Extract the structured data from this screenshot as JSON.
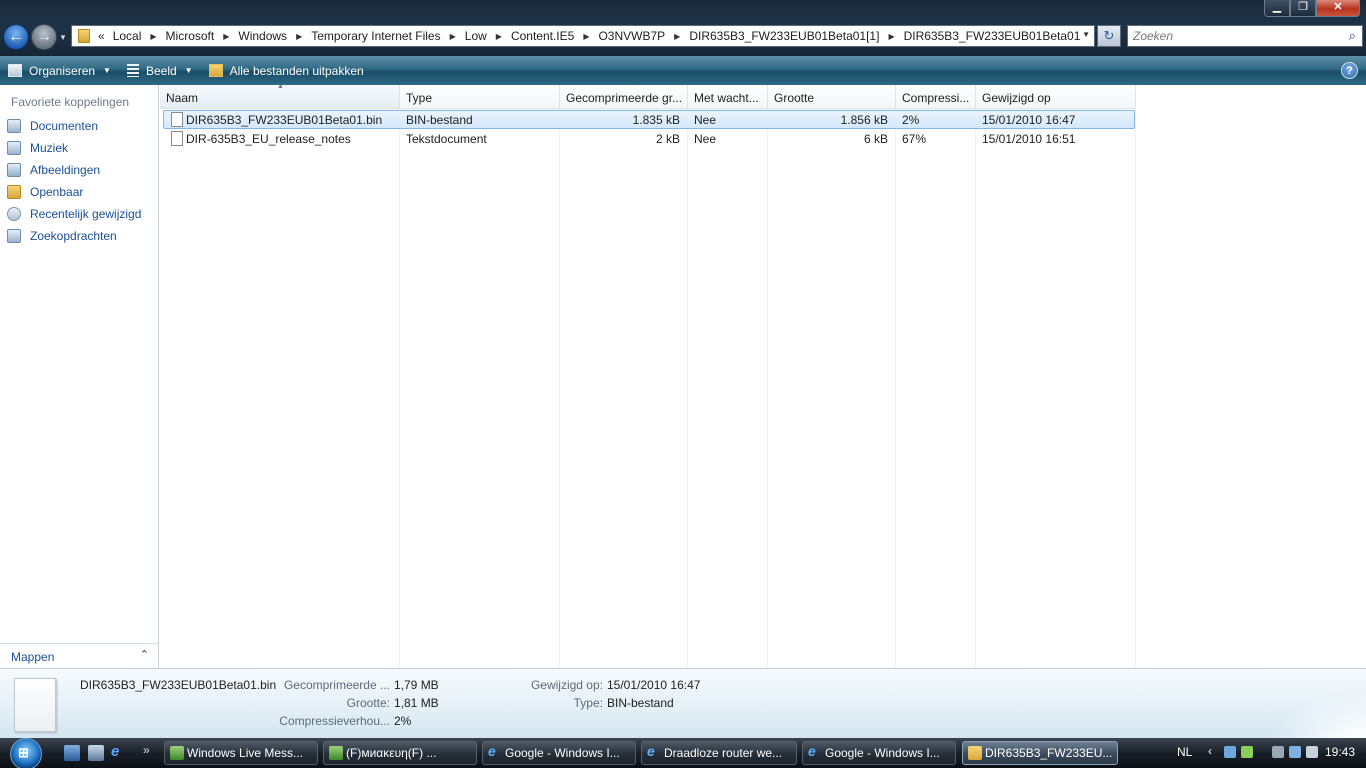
{
  "window": {
    "controls": {
      "minimize": "▁",
      "maximize": "❐",
      "close": "✕"
    }
  },
  "nav": {
    "back": "←",
    "forward": "→",
    "dropdown": "▼"
  },
  "address": {
    "chevron": "«",
    "segments": [
      "Local",
      "Microsoft",
      "Windows",
      "Temporary Internet Files",
      "Low",
      "Content.IE5",
      "O3NVWB7P",
      "DIR635B3_FW233EUB01Beta01[1]",
      "DIR635B3_FW233EUB01Beta01"
    ],
    "separator": "▶",
    "dropdown": "▼",
    "refresh": "↻"
  },
  "search": {
    "placeholder": "Zoeken",
    "icon": "⌕"
  },
  "toolbar": {
    "organize": "Organiseren",
    "view": "Beeld",
    "extract": "Alle bestanden uitpakken",
    "dropdown": "▼",
    "help": "?"
  },
  "navpane": {
    "heading": "Favoriete koppelingen",
    "items": [
      "Documenten",
      "Muziek",
      "Afbeeldingen",
      "Openbaar",
      "Recentelijk gewijzigd",
      "Zoekopdrachten"
    ],
    "folders": "Mappen",
    "folders_toggle": "⌃"
  },
  "columns": [
    "Naam",
    "Type",
    "Gecomprimeerde gr...",
    "Met wacht...",
    "Grootte",
    "Compressi...",
    "Gewijzigd op"
  ],
  "sort_indicator": "▲",
  "files": [
    {
      "name": "DIR635B3_FW233EUB01Beta01.bin",
      "type": "BIN-bestand",
      "compressed": "1.835 kB",
      "password": "Nee",
      "size": "1.856 kB",
      "ratio": "2%",
      "modified": "15/01/2010 16:47"
    },
    {
      "name": "DIR-635B3_EU_release_notes",
      "type": "Tekstdocument",
      "compressed": "2 kB",
      "password": "Nee",
      "size": "6 kB",
      "ratio": "67%",
      "modified": "15/01/2010 16:51"
    }
  ],
  "details": {
    "filename": "DIR635B3_FW233EUB01Beta01.bin",
    "compressed_label": "Gecomprimeerde ...",
    "compressed_value": "1,79 MB",
    "size_label": "Grootte:",
    "size_value": "1,81 MB",
    "ratio_label": "Compressieverhou...",
    "ratio_value": "2%",
    "modified_label": "Gewijzigd op:",
    "modified_value": "15/01/2010 16:47",
    "type_label": "Type:",
    "type_value": "BIN-bestand"
  },
  "taskbar": {
    "start_glyph": "⊞",
    "quicklaunch_more": "»",
    "ie_glyph": "e",
    "tasks": [
      {
        "label": "Windows Live Mess...",
        "icon": "msn"
      },
      {
        "label": "(F)миακευη(F)      ...",
        "icon": "msn"
      },
      {
        "label": "Google - Windows I...",
        "icon": "ie"
      },
      {
        "label": "Draadloze router we...",
        "icon": "ie"
      },
      {
        "label": "Google - Windows I...",
        "icon": "ie"
      },
      {
        "label": "DIR635B3_FW233EU...",
        "icon": "folder"
      }
    ],
    "language": "NL",
    "tray_arrow": "‹",
    "clock": "19:43"
  },
  "colors": {
    "toolbar": "#2f6985",
    "link": "#1b4f99",
    "selection": "#d3e8fb"
  }
}
